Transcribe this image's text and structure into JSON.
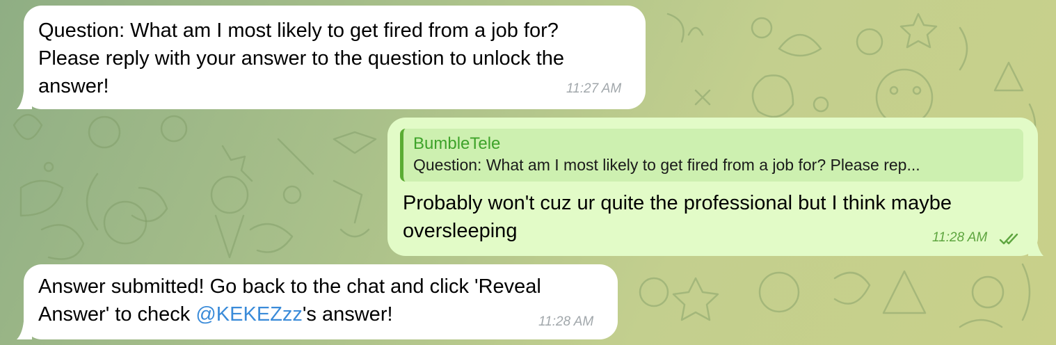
{
  "messages": [
    {
      "direction": "incoming",
      "text": "Question: What am I most likely to get fired from a job for?\nPlease reply with your answer to the question to unlock the\nanswer!",
      "time": "11:27 AM"
    },
    {
      "direction": "outgoing",
      "reply_to": {
        "sender": "BumbleTele",
        "snippet": "Question: What am I most likely to get fired from a job for? Please rep..."
      },
      "text": "Probably won't cuz ur quite the professional but I think maybe\noversleeping",
      "time": "11:28 AM",
      "status_icon": "double-check-icon"
    },
    {
      "direction": "incoming",
      "text_before": "Answer submitted! Go back to the chat and click 'Reveal\nAnswer' to check ",
      "mention": "@KEKEZzz",
      "text_after": "'s answer!",
      "time": "11:28 AM"
    }
  ],
  "colors": {
    "incoming_bubble": "#ffffff",
    "outgoing_bubble": "#e2fbc7",
    "reply_accent": "#5aac33",
    "mention": "#3a8bd9",
    "outgoing_time": "#5ea53f",
    "incoming_time": "#a1a7ab"
  }
}
